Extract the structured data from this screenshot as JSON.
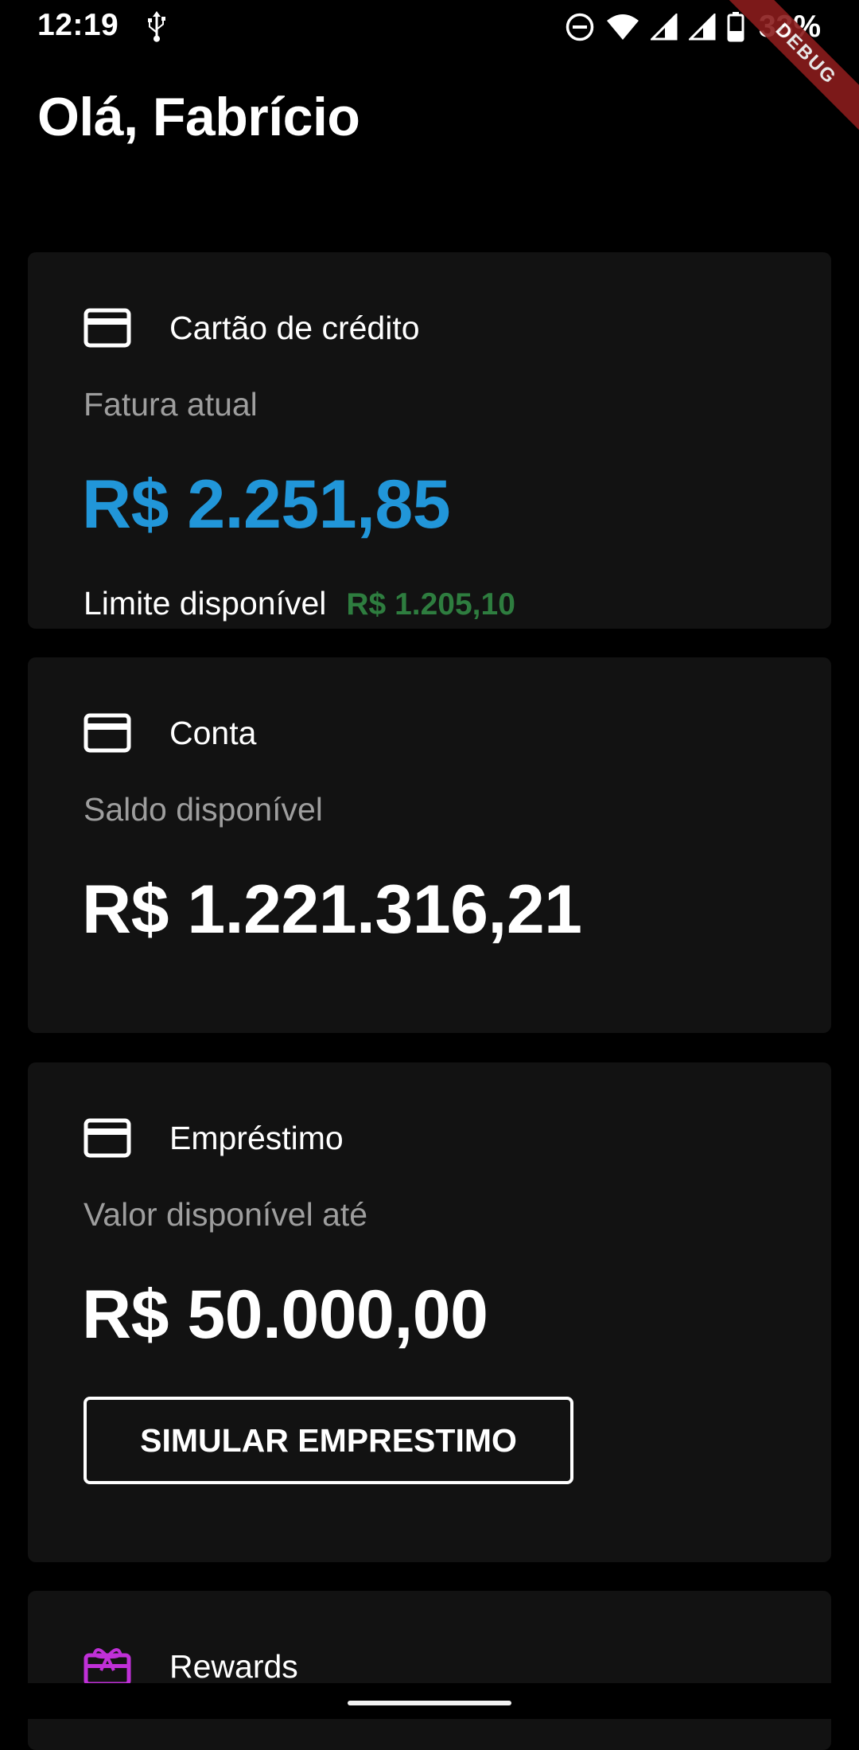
{
  "status_bar": {
    "time": "12:19",
    "battery": "33%",
    "icons": [
      "usb-icon",
      "do-not-disturb-icon",
      "wifi-icon",
      "signal-icon",
      "signal-icon",
      "battery-icon"
    ]
  },
  "debug_banner": "DEBUG",
  "greeting": "Olá, Fabrício",
  "cards": {
    "credit": {
      "icon": "credit-card-icon",
      "title": "Cartão de crédito",
      "subtitle": "Fatura atual",
      "amount": "R$ 2.251,85",
      "limit_label": "Limite disponível",
      "limit_value": "R$ 1.205,10"
    },
    "account": {
      "icon": "credit-card-icon",
      "title": "Conta",
      "subtitle": "Saldo disponível",
      "amount": "R$ 1.221.316,21"
    },
    "loan": {
      "icon": "credit-card-icon",
      "title": "Empréstimo",
      "subtitle": "Valor disponível até",
      "amount": "R$ 50.000,00",
      "button_label": "SIMULAR EMPRESTIMO"
    },
    "rewards": {
      "icon": "gift-card-icon",
      "title": "Rewards"
    }
  },
  "colors": {
    "background": "#000000",
    "card": "#121212",
    "accent_blue": "#2196d9",
    "limit_green": "#2e7d3f",
    "rewards_icon": "#c030d8",
    "muted_text": "#9e9e9e"
  }
}
